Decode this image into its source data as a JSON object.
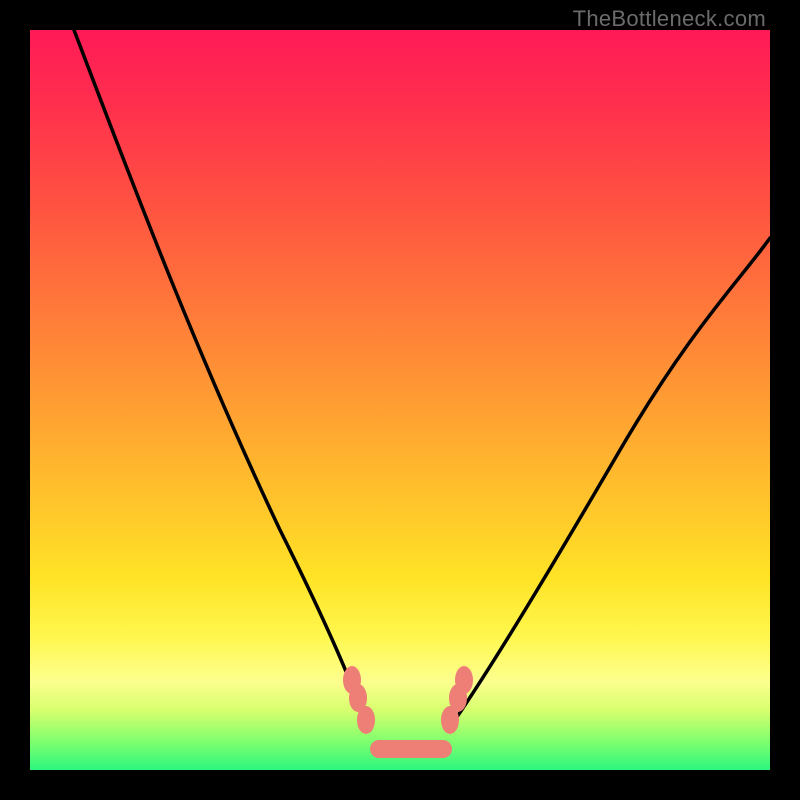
{
  "watermark": "TheBottleneck.com",
  "chart_data": {
    "type": "line",
    "title": "",
    "xlabel": "",
    "ylabel": "",
    "xlim": [
      0,
      100
    ],
    "ylim": [
      0,
      100
    ],
    "description": "Two black bottleneck curves descending from top corners into a flat coral-dotted trough near the optimum; background gradient encodes bottleneck severity (red=worst, green=best).",
    "series": [
      {
        "name": "left-curve",
        "x": [
          6,
          10,
          15,
          20,
          25,
          30,
          35,
          40,
          43,
          45,
          46.5
        ],
        "y": [
          100,
          88,
          74,
          61,
          49,
          38,
          28,
          18,
          12,
          8,
          5
        ]
      },
      {
        "name": "right-curve",
        "x": [
          57,
          60,
          65,
          70,
          75,
          80,
          85,
          90,
          95,
          100
        ],
        "y": [
          5,
          8,
          14,
          23,
          33,
          43,
          52,
          60,
          66,
          72
        ]
      },
      {
        "name": "trough-markers",
        "type": "scatter",
        "x": [
          44,
          45,
          46,
          48,
          50,
          52,
          54,
          55.5,
          57,
          58
        ],
        "y": [
          12,
          9,
          6,
          4,
          4,
          4,
          4,
          6,
          9,
          12
        ]
      }
    ],
    "background_gradient": {
      "top": "#ff1a57",
      "middle": "#ffe326",
      "bottom": "#2cf57e"
    },
    "marker_color": "#f08077",
    "curve_color": "#000000"
  }
}
